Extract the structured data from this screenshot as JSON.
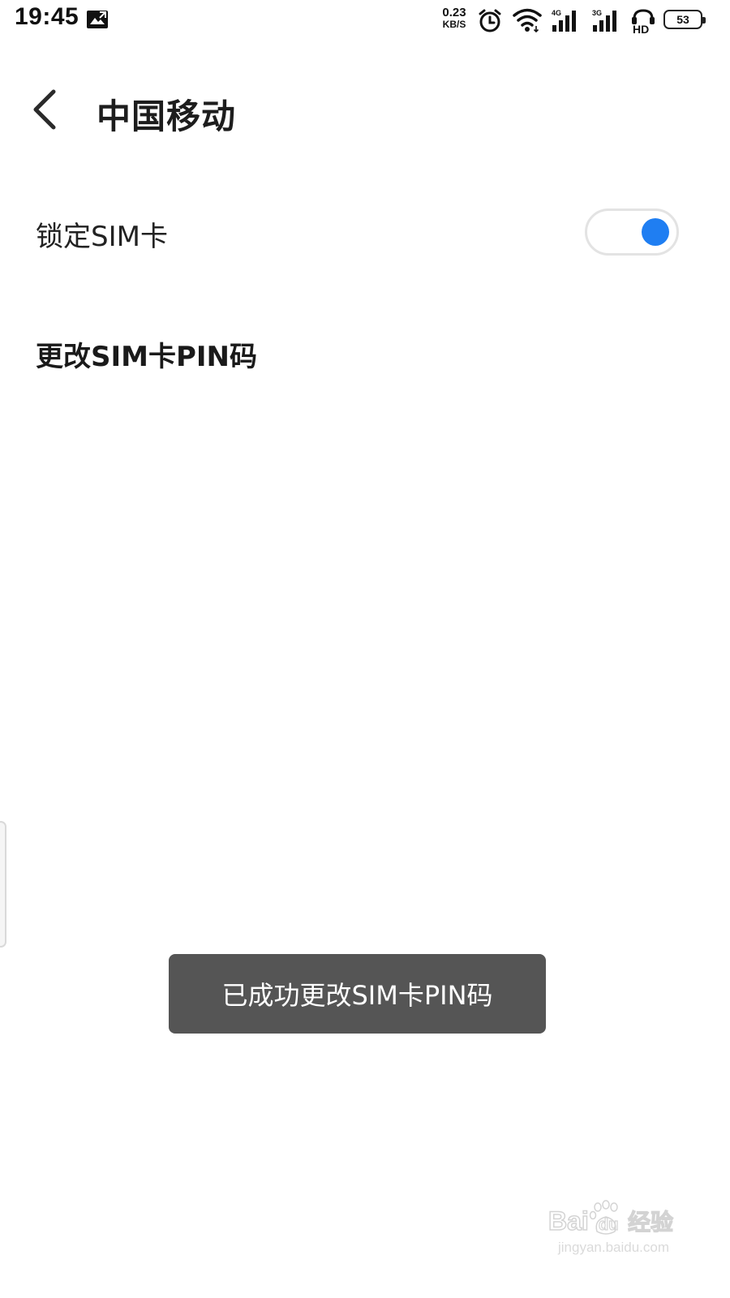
{
  "status_bar": {
    "time": "19:45",
    "net_speed_value": "0.23",
    "net_speed_unit": "KB/S",
    "signal1_tech": "4G",
    "signal2_tech": "3G",
    "hd_label": "HD",
    "battery_percent": "53",
    "icons": [
      "image-notification-icon",
      "alarm-icon",
      "wifi-icon",
      "signal-4g-icon",
      "signal-3g-icon",
      "hd-voice-icon",
      "battery-icon"
    ]
  },
  "header": {
    "back_icon": "chevron-left-icon",
    "title": "中国移动"
  },
  "settings": {
    "lock_sim_label": "锁定SIM卡",
    "lock_sim_enabled": true,
    "change_pin_label": "更改SIM卡PIN码"
  },
  "toast": {
    "message": "已成功更改SIM卡PIN码"
  },
  "watermark": {
    "logo_text": "Baidu经验",
    "url": "jingyan.baidu.com"
  },
  "colors": {
    "toggle_on": "#1f7ef2",
    "toast_bg": "#555555",
    "text": "#1f1f1f",
    "background": "#ffffff"
  }
}
